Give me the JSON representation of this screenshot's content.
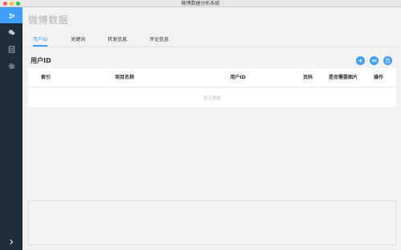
{
  "window": {
    "title": "微博数据分析系统"
  },
  "sidebar": {
    "items": [
      {
        "icon": "gear-people-icon",
        "active": true
      },
      {
        "icon": "chat-bubbles-icon",
        "active": false
      },
      {
        "icon": "document-icon",
        "active": false
      },
      {
        "icon": "settings-icon",
        "active": false
      }
    ],
    "expand_icon": "chevron-right-icon",
    "expand_label": ">"
  },
  "page": {
    "title": "微博数据"
  },
  "tabs": [
    {
      "label": "用户ID",
      "active": true
    },
    {
      "label": "关键词",
      "active": false
    },
    {
      "label": "转发信息",
      "active": false
    },
    {
      "label": "评论信息",
      "active": false
    }
  ],
  "section": {
    "title": "用户ID",
    "actions": [
      {
        "icon": "plus-icon"
      },
      {
        "icon": "eye-icon"
      },
      {
        "icon": "trash-icon"
      }
    ]
  },
  "table": {
    "columns": [
      "索引",
      "项目名称",
      "用户ID",
      "页码",
      "是否需要图片",
      "操作"
    ],
    "empty_text": "暂无数据"
  },
  "colors": {
    "accent": "#409eff",
    "sidebar": "#1f2d3d"
  }
}
